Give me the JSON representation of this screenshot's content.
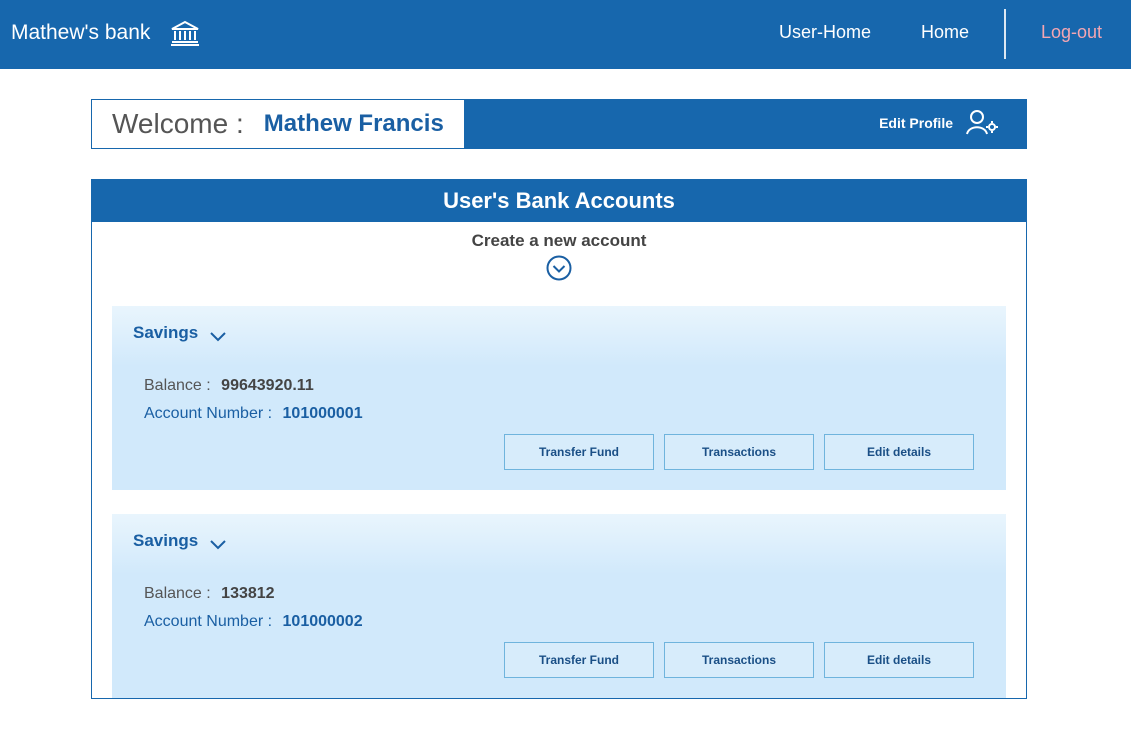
{
  "navbar": {
    "brand": "Mathew's bank",
    "brand_icon": "bank-icon",
    "links": {
      "user_home": "User-Home",
      "home": "Home",
      "logout": "Log-out"
    },
    "colors": {
      "bar": "#1767ad",
      "logout": "#f4a6b2"
    }
  },
  "welcome": {
    "label": "Welcome :",
    "name": "Mathew Francis",
    "edit_profile": "Edit Profile",
    "edit_profile_icon": "user-settings-icon"
  },
  "accounts": {
    "title": "User's Bank Accounts",
    "create_label": "Create a new account",
    "create_icon": "chevron-down-circle-icon",
    "items": [
      {
        "type": "Savings",
        "balance_label": "Balance :",
        "balance": "99643920.11",
        "account_label": "Account Number :",
        "account_number": "101000001",
        "buttons": {
          "transfer": "Transfer Fund",
          "transactions": "Transactions",
          "edit": "Edit details"
        }
      },
      {
        "type": "Savings",
        "balance_label": "Balance :",
        "balance": "133812",
        "account_label": "Account Number :",
        "account_number": "101000002",
        "buttons": {
          "transfer": "Transfer Fund",
          "transactions": "Transactions",
          "edit": "Edit details"
        }
      }
    ]
  }
}
